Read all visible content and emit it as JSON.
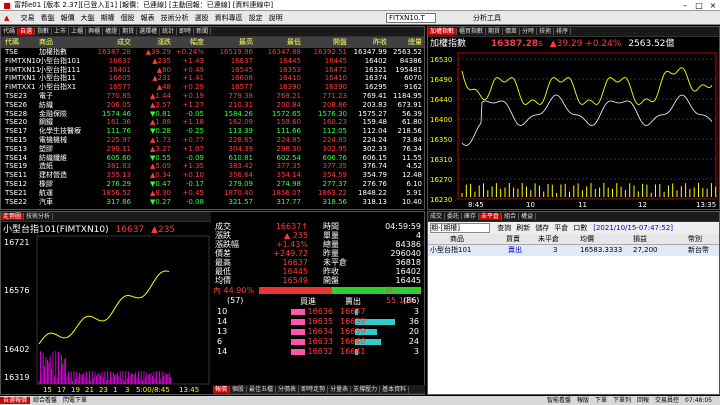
{
  "window": {
    "title": "富邦e01 [版本 2.37][已登入][1] [報價：已連線] [主動回報：已連線] [資料連線中]"
  },
  "menu": {
    "items": [
      "交易",
      "看盤",
      "報價",
      "大盤",
      "期權",
      "個股",
      "報表",
      "技術分析",
      "選股",
      "資料專區",
      "設定",
      "說明"
    ],
    "symbol_box": "FITXN10.T",
    "extra": "分析工具"
  },
  "quote": {
    "tabs": [
      "代碼",
      "自選",
      "指數",
      "上市",
      "上櫃",
      "興櫃",
      "權證",
      "期貨",
      "選擇權",
      "統計",
      "即時",
      "新聞"
    ],
    "headers": [
      "代碼",
      "商品",
      "成交",
      "漲跌",
      "幅度",
      "最高",
      "最低",
      "開盤",
      "昨收",
      "總量"
    ],
    "rows": [
      {
        "code": "TSE",
        "name": "加權指數",
        "last": "16387.28",
        "chg": "▲39.29",
        "pct": "+0.24%",
        "high": "16519.96",
        "low": "16347.88",
        "open": "16392.51",
        "prev": "16347.99",
        "vol": "2563.52",
        "c": "red"
      },
      {
        "code": "FIMTXN10",
        "name": "小型台指101",
        "last": "16637",
        "chg": "▲235",
        "pct": "+1.43",
        "high": "16637",
        "low": "16445",
        "open": "16445",
        "prev": "16402",
        "vol": "84386",
        "c": "red"
      },
      {
        "code": "FIMTXN11",
        "name": "小型台指111",
        "last": "16401",
        "chg": "▲80",
        "pct": "+0.49",
        "high": "16545",
        "low": "16353",
        "open": "16472",
        "prev": "16321",
        "vol": "195481",
        "c": "red"
      },
      {
        "code": "FIMTXN1",
        "name": "小型台指11",
        "last": "16605",
        "chg": "▲231",
        "pct": "+1.41",
        "high": "16608",
        "low": "16410",
        "open": "16410",
        "prev": "16374",
        "vol": "6070",
        "c": "red"
      },
      {
        "code": "FIMTXX1",
        "name": "小型台指X1",
        "last": "16577",
        "chg": "▲48",
        "pct": "+0.29",
        "high": "16577",
        "low": "16390",
        "open": "16390",
        "prev": "16295",
        "vol": "9162",
        "c": "red"
      },
      {
        "code": "TSE23",
        "name": "電子",
        "last": "770.85",
        "chg": "▲1.44",
        "pct": "+0.19",
        "high": "779.38",
        "low": "769.21",
        "open": "771.23",
        "prev": "769.41",
        "vol": "1184.95",
        "c": "red"
      },
      {
        "code": "TSE26",
        "name": "紡織",
        "last": "206.05",
        "chg": "▲2.57",
        "pct": "+1.27",
        "high": "210.31",
        "low": "200.84",
        "open": "208.86",
        "prev": "203.83",
        "vol": "673.91",
        "c": "red"
      },
      {
        "code": "TSE28",
        "name": "金融保險",
        "last": "1574.46",
        "chg": "▼0.81",
        "pct": "-0.05",
        "high": "1584.26",
        "low": "1572.65",
        "open": "1576.30",
        "prev": "1575.27",
        "vol": "56.39",
        "c": "grn"
      },
      {
        "code": "TSE20",
        "name": "鋼鐵",
        "last": "161.36",
        "chg": "▲1.88",
        "pct": "+1.18",
        "high": "162.09",
        "low": "159.60",
        "open": "160.23",
        "prev": "159.48",
        "vol": "61.80",
        "c": "red"
      },
      {
        "code": "TSE17",
        "name": "化學生技醫療",
        "last": "111.76",
        "chg": "▼0.28",
        "pct": "-0.25",
        "high": "113.39",
        "low": "111.66",
        "open": "112.05",
        "prev": "112.04",
        "vol": "218.56",
        "c": "grn"
      },
      {
        "code": "TSE15",
        "name": "電機機械",
        "last": "225.97",
        "chg": "▲1.73",
        "pct": "+0.77",
        "high": "228.65",
        "low": "224.85",
        "open": "224.85",
        "prev": "224.24",
        "vol": "73.84",
        "c": "red"
      },
      {
        "code": "TSE13",
        "name": "塑膠",
        "last": "299.11",
        "chg": "▲3.27",
        "pct": "+1.07",
        "high": "304.39",
        "low": "298.30",
        "open": "302.95",
        "prev": "302.33",
        "vol": "76.34",
        "c": "red"
      },
      {
        "code": "TSE14",
        "name": "紡織纖維",
        "last": "605.60",
        "chg": "▼0.55",
        "pct": "-0.09",
        "high": "610.81",
        "low": "602.54",
        "open": "606.76",
        "prev": "606.15",
        "vol": "11.55",
        "c": "grn"
      },
      {
        "code": "TSE19",
        "name": "造紙",
        "last": "381.83",
        "chg": "▲5.09",
        "pct": "+1.35",
        "high": "383.42",
        "low": "377.35",
        "open": "377.35",
        "prev": "376.74",
        "vol": "4.52",
        "c": "red"
      },
      {
        "code": "TSE11",
        "name": "建材營造",
        "last": "355.13",
        "chg": "▲0.34",
        "pct": "+0.10",
        "high": "356.64",
        "low": "354.14",
        "open": "354.59",
        "prev": "354.79",
        "vol": "12.48",
        "c": "red"
      },
      {
        "code": "TSE12",
        "name": "橡膠",
        "last": "276.29",
        "chg": "▼0.47",
        "pct": "-0.17",
        "high": "279.09",
        "low": "274.98",
        "open": "277.37",
        "prev": "276.76",
        "vol": "6.10",
        "c": "grn"
      },
      {
        "code": "TSE21",
        "name": "航運",
        "last": "1856.52",
        "chg": "▲8.30",
        "pct": "+0.45",
        "high": "1870.40",
        "low": "1856.07",
        "open": "1863.22",
        "prev": "1848.22",
        "vol": "5.91",
        "c": "red"
      },
      {
        "code": "TSE22",
        "name": "汽車",
        "last": "317.86",
        "chg": "▼0.27",
        "pct": "-0.08",
        "high": "321.57",
        "low": "317.77",
        "open": "318.56",
        "prev": "318.13",
        "vol": "10.40",
        "c": "grn"
      }
    ]
  },
  "index_panel": {
    "tabs": [
      "加權指數",
      "櫃買指數",
      "期貨",
      "價差",
      "分時",
      "技術",
      "排序"
    ],
    "name": "加權指數",
    "last": "16387.28",
    "unit": "s",
    "chg": "▲39.29",
    "pct": "+0.24%",
    "vol": "2563.52億",
    "yticks": [
      "16530",
      "16490",
      "16440",
      "16400",
      "16350",
      "16310",
      "16270",
      "16230"
    ],
    "xticks": [
      "8:45",
      "10",
      "11",
      "12",
      "13:35"
    ]
  },
  "futures": {
    "title": "小型台指101(FIMTXN10)",
    "last": "16637",
    "chg": "▲235",
    "time": "04:59:59",
    "yticks": [
      "16721",
      "16576",
      "16402",
      "16319"
    ],
    "xticks": [
      "15",
      "17",
      "19",
      "21",
      "23",
      "1",
      "3",
      "5:00/8:45",
      "13:45"
    ],
    "stats": [
      [
        "成交",
        "16637↑",
        "時間",
        "04:59:59"
      ],
      [
        "漲跌",
        "▲ 235",
        "單量",
        "4"
      ],
      [
        "漲跌幅",
        "+1.43%",
        "總量",
        "84386"
      ],
      [
        "價差",
        "+249.72",
        "昨量",
        "296040"
      ],
      [
        "最高",
        "16637",
        "未平倉",
        "36818"
      ],
      [
        "最低",
        "16445",
        "昨收",
        "16402"
      ],
      [
        "均價",
        "16549",
        "開盤",
        "16445"
      ]
    ],
    "ratio_in": "內 44.90%",
    "ratio_out": "外 55.10%",
    "buy_total": "(57)",
    "sell_total": "(86)",
    "buy_label": "買進",
    "sell_label": "賣出",
    "book": [
      [
        "10",
        "16636",
        "16637",
        "3"
      ],
      [
        "14",
        "16635",
        "16638",
        "36"
      ],
      [
        "13",
        "16634",
        "16639",
        "20"
      ],
      [
        "6",
        "16633",
        "16640",
        "24"
      ],
      [
        "14",
        "16632",
        "16641",
        "3"
      ]
    ],
    "bottom_tabs": [
      "報價",
      "個股",
      "最佳五檔",
      "分價表",
      "即時走勢",
      "分量表",
      "支撐壓力",
      "基本資料"
    ]
  },
  "order": {
    "tabs": [
      "成交",
      "委託",
      "庫存",
      "未平倉",
      "組合",
      "權益"
    ],
    "account": "期-[期權]",
    "btns": [
      "查詢",
      "刷新",
      "儲存",
      "平倉",
      "口數"
    ],
    "datetime": "[2021/10/15-07:47:52]",
    "headers": [
      "商品",
      "買賣",
      "未平倉",
      "均價",
      "損益",
      "幣別"
    ],
    "row": [
      "小型台指101",
      "賣出",
      "3",
      "16583.3333",
      "27,200",
      "新台幣"
    ]
  },
  "statusbar": {
    "left": [
      "自選報價",
      "綜合看盤",
      "閃電下單"
    ],
    "right": [
      "智能看盤",
      "報版",
      "下單",
      "下單列",
      "回報",
      "交易員控"
    ],
    "time": "07:48:05"
  }
}
